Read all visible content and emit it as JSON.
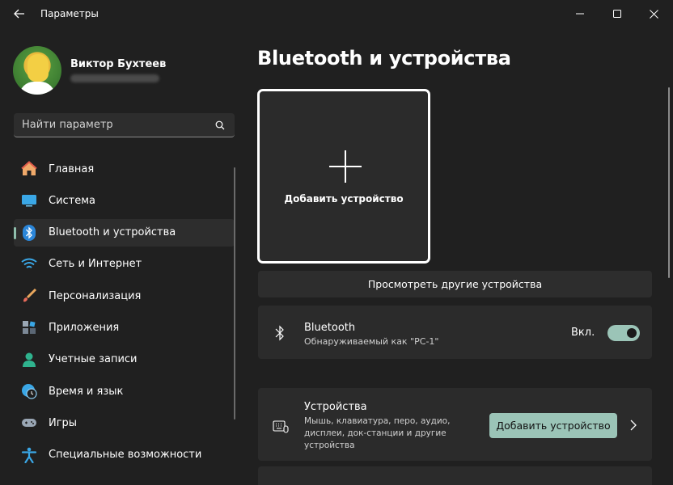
{
  "window": {
    "title": "Параметры"
  },
  "user": {
    "name": "Виктор Бухтеев"
  },
  "search": {
    "placeholder": "Найти параметр"
  },
  "sidebar": {
    "items": [
      {
        "label": "Главная",
        "icon": "home-icon"
      },
      {
        "label": "Система",
        "icon": "system-display-icon"
      },
      {
        "label": "Bluetooth и устройства",
        "icon": "bluetooth-icon",
        "active": true
      },
      {
        "label": "Сеть и Интернет",
        "icon": "wifi-icon"
      },
      {
        "label": "Персонализация",
        "icon": "brush-icon"
      },
      {
        "label": "Приложения",
        "icon": "apps-icon"
      },
      {
        "label": "Учетные записи",
        "icon": "account-icon"
      },
      {
        "label": "Время и язык",
        "icon": "time-language-icon"
      },
      {
        "label": "Игры",
        "icon": "gamepad-icon"
      },
      {
        "label": "Специальные возможности",
        "icon": "accessibility-icon"
      }
    ]
  },
  "main": {
    "title": "Bluetooth и устройства",
    "add_tile_label": "Добавить устройство",
    "view_more_label": "Просмотреть другие устройства",
    "bluetooth": {
      "title": "Bluetooth",
      "subtitle": "Обнаруживаемый как \"PC-1\"",
      "state_label": "Вкл.",
      "enabled": true
    },
    "devices": {
      "title": "Устройства",
      "description": "Мышь, клавиатура, перо, аудио, дисплеи, док-станции и другие устройства",
      "button_label": "Добавить устройство"
    }
  },
  "colors": {
    "background": "#202020",
    "card": "#2b2b2b",
    "accent": "#9bc4b7"
  }
}
